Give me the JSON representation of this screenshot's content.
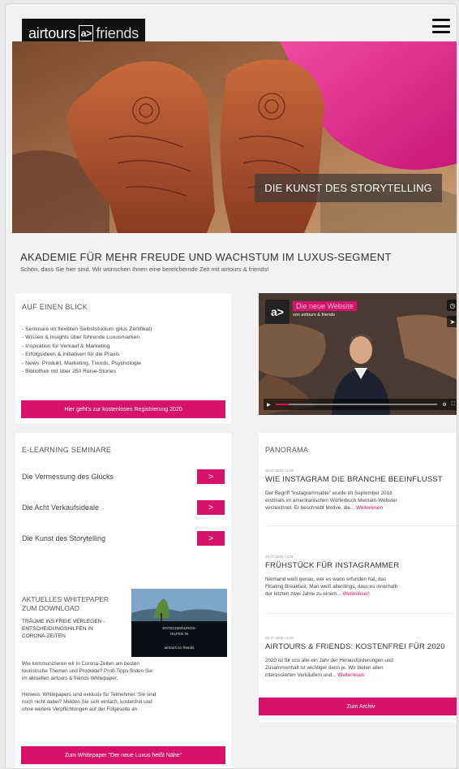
{
  "header": {
    "logo_left": "airtours",
    "logo_mark": "a>",
    "logo_right": "friends"
  },
  "hero": {
    "caption": "DIE KUNST DES STORYTELLING"
  },
  "intro": {
    "title": "AKADEMIE FÜR MEHR FREUDE UND WACHSTUM IM LUXUS-SEGMENT",
    "text": "Schön, dass Sie hier sind. Wir wünschen Ihnen eine bereichernde Zeit mit airtours & friends!"
  },
  "overview": {
    "title": "AUF EINEN BLICK",
    "items": [
      "- Seminare im flexiblen Selbststudium (plus Zertifikat)",
      "- Wissen & Insights über führende Luxusmarken",
      "- Inspiration für Verkauf & Marketing",
      "- Erfolgsideen & Initiativen für die Praxis",
      "- News: Produkt, Marketing, Trends, Psychologie",
      "- Bibliothek mit über 250 Reise-Stories"
    ],
    "button": "Hier geht's zur kostenlosen Registrierung 2020"
  },
  "video": {
    "logo": "a>",
    "title": "Die neue Website",
    "subtitle": "von airtours & friends",
    "progress": 0.08
  },
  "seminars": {
    "title": "E-LEARNING SEMINARE",
    "items": [
      {
        "label": "Die Vermessung des Glücks",
        "arrow": ">"
      },
      {
        "label": "Die Acht Verkaufsideale",
        "arrow": ">"
      },
      {
        "label": "Die Kunst des Storytelling",
        "arrow": ">"
      }
    ]
  },
  "whitepaper": {
    "title_line1": "AKTUELLES WHITEPAPER",
    "title_line2": "ZUM DOWNLOAD",
    "sub_line1": "TRÄUME INS FREIE VERLEGEN -",
    "sub_line2": "ENTSCHEIDUNGSHILFEN IN",
    "sub_line3": "CORONA-ZEITEN",
    "thumb_line1": "ENTSCHEIDUNGS-",
    "thumb_line2": "HILFEN IN",
    "thumb_brand": "airtours a> friends",
    "p1_line1": "Wie kommunizieren wir in Corona-Zeiten am besten",
    "p1_line2": "touristische Themen und Produkte? Profi-Tipps finden Sie",
    "p1_line3": "im aktuellen airtours & friends Whitepaper.",
    "p2_line1": "Hinweis: Whitepapers sind exklusiv für Teilnehmer. Sie sind",
    "p2_line2": "noch nicht dabei? Melden Sie sich einfach, kostenfrei und",
    "p2_line3": "ohne weitere Verpflichtungen auf der Folgeseite an.",
    "button": "Zum Whitepaper \"Der neue Luxus heißt Nähe\""
  },
  "panorama": {
    "title": "PANORAMA",
    "more": "Weiterlesen",
    "archive_button": "Zum Archiv",
    "posts": [
      {
        "date": "30.07.2020 / 4:05",
        "title": "WIE INSTAGRAM DIE BRANCHE BEEINFLUSST",
        "line1": "Der Begriff \"instagrammable\" wurde im September 2018",
        "line2": "erstmals im amerikanischen Wörterbuch Merriam-Webster",
        "line3": "verzeichnet. Er beschreibt Motive, die..."
      },
      {
        "date": "29.07.2020 / 3:31",
        "title": "FRÜHSTÜCK FÜR INSTAGRAMMER",
        "line1": "Niemand weiß genau, wer es wann erfunden hat, das",
        "line2": "Floating Breakfast. Man weiß allerdings, dass es innerhalb",
        "line3": "der letzten zwei Jahre zu einem..."
      },
      {
        "date": "28.07.2020 / 8:46",
        "title": "AIRTOURS & FRIENDS: KOSTENFREI FÜR 2020",
        "line1": "2020 ist für uns alle ein Jahr der Herausforderungen und",
        "line2": "Zusammenhalt ist wichtiger denn je. Wir bieten allen",
        "line3": "interessierten Verkäufern und..."
      }
    ]
  },
  "colors": {
    "accent": "#d7126b",
    "logo_bg": "#111111"
  }
}
